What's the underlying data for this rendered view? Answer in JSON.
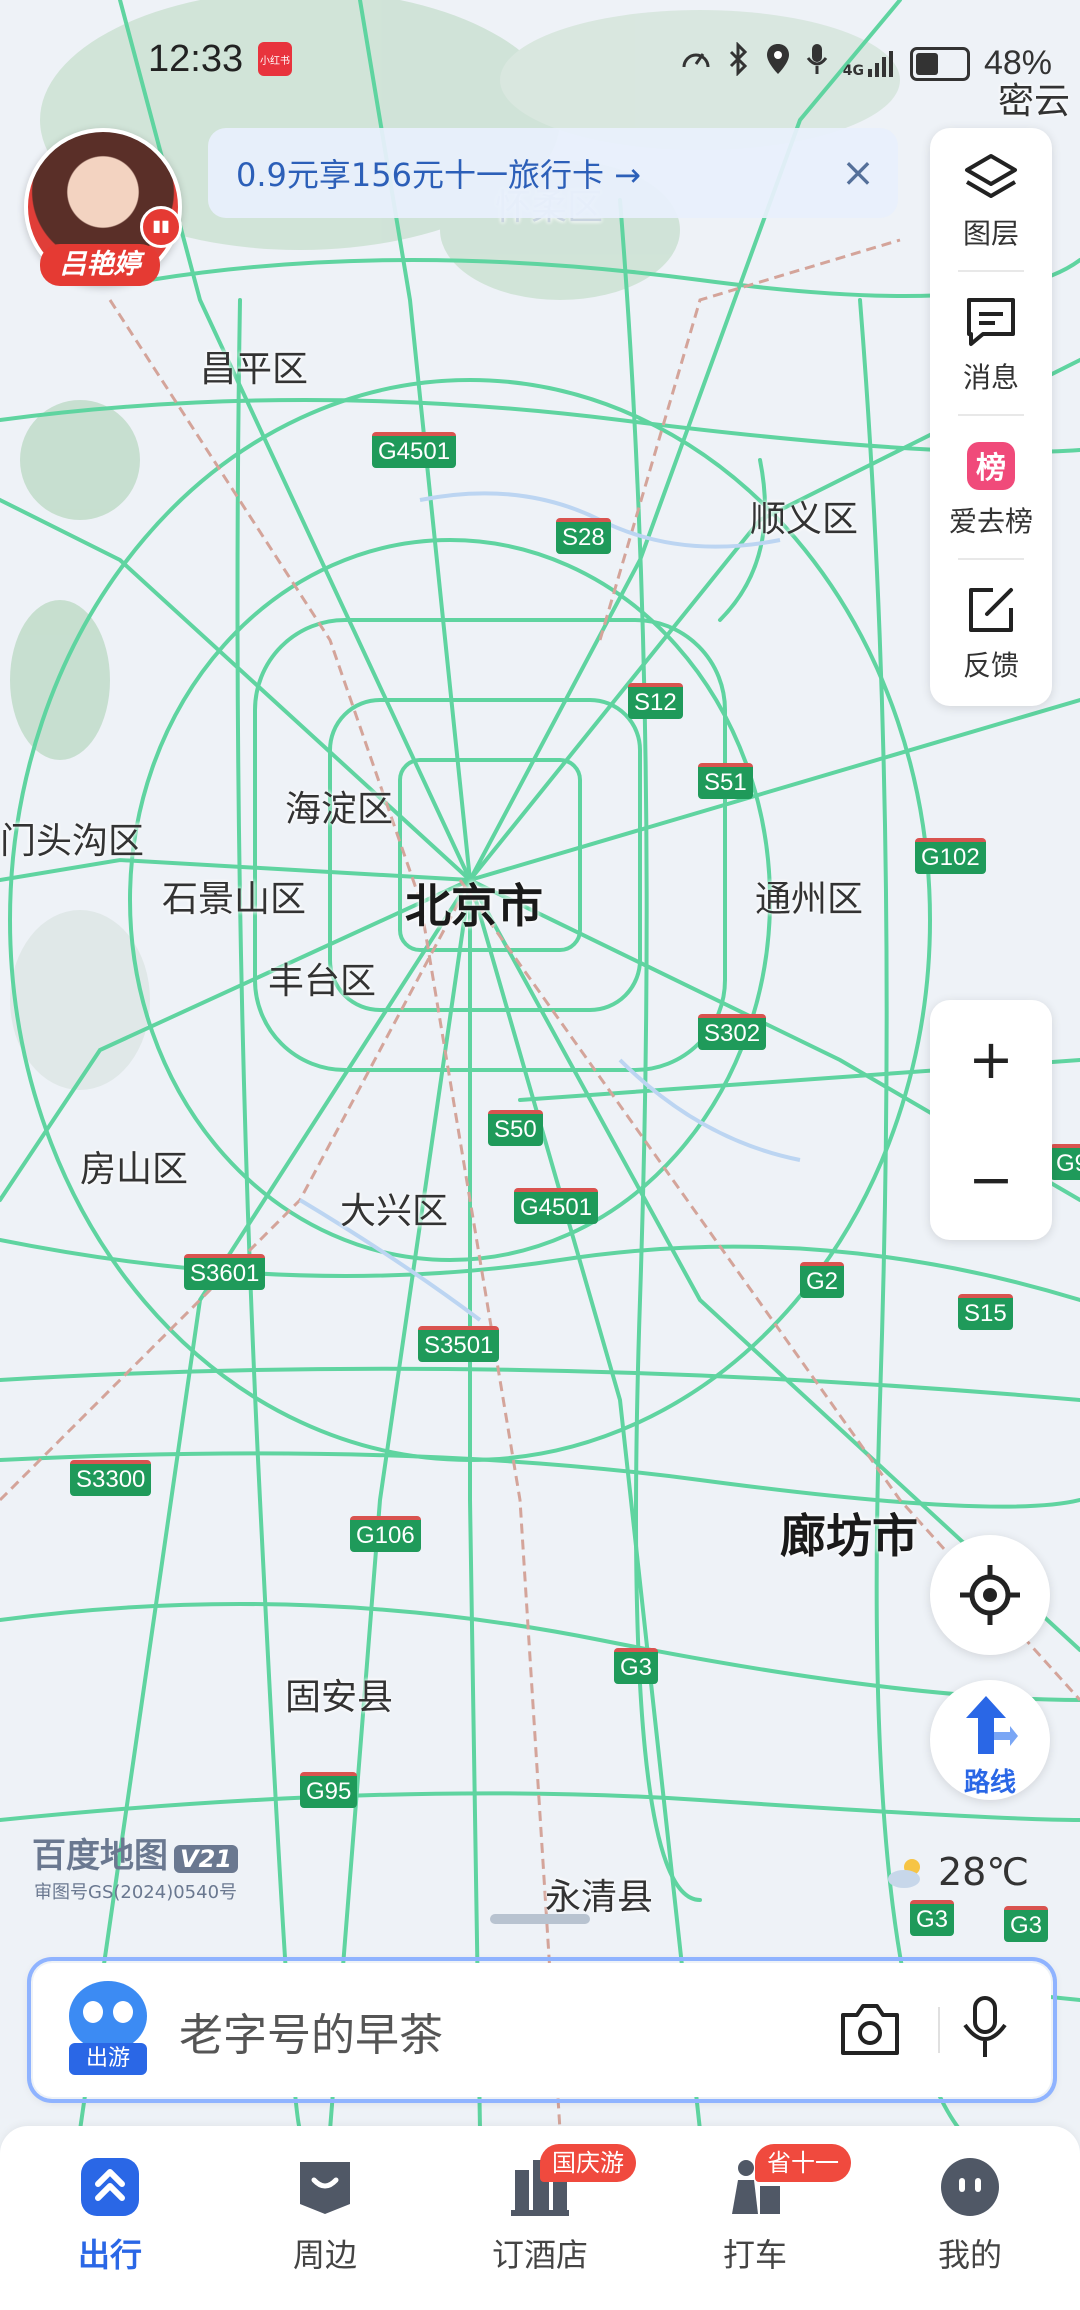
{
  "status_bar": {
    "time": "12:33",
    "app_badge": "小红书",
    "network": "4G",
    "battery": "48%"
  },
  "live_avatar": {
    "name": "吕艳婷"
  },
  "promo_banner": {
    "text": "0.9元享156元十一旅行卡 →",
    "close": "×"
  },
  "side_tools": [
    {
      "label": "图层",
      "icon": "layers-icon"
    },
    {
      "label": "消息",
      "icon": "message-icon"
    },
    {
      "label": "爱去榜",
      "icon": "ranking-icon"
    },
    {
      "label": "反馈",
      "icon": "feedback-icon"
    }
  ],
  "zoom": {
    "in": "+",
    "out": "−"
  },
  "route_button": {
    "label": "路线"
  },
  "map": {
    "brand": "百度地图",
    "brand_version": "V21",
    "approval_no": "审图号GS(2024)0540号",
    "weather": "28℃",
    "places": [
      {
        "name": "密云",
        "size": "md"
      },
      {
        "name": "怀柔区",
        "size": "md"
      },
      {
        "name": "昌平区",
        "size": "md"
      },
      {
        "name": "顺义区",
        "size": "md"
      },
      {
        "name": "海淀区",
        "size": "md"
      },
      {
        "name": "门头沟区",
        "size": "md"
      },
      {
        "name": "石景山区",
        "size": "md"
      },
      {
        "name": "北京市",
        "size": "lg"
      },
      {
        "name": "通州区",
        "size": "md"
      },
      {
        "name": "丰台区",
        "size": "md"
      },
      {
        "name": "房山区",
        "size": "md"
      },
      {
        "name": "大兴区",
        "size": "md"
      },
      {
        "name": "廊坊市",
        "size": "lg"
      },
      {
        "name": "固安县",
        "size": "md"
      },
      {
        "name": "永清县",
        "size": "md"
      }
    ],
    "road_shields": [
      "G4501",
      "S28",
      "S12",
      "S51",
      "G102",
      "S302",
      "S50",
      "G4501",
      "G9",
      "G2",
      "S15",
      "S3601",
      "S3501",
      "S3300",
      "G106",
      "G3",
      "G95",
      "G3",
      "G3"
    ]
  },
  "search": {
    "placeholder": "老字号的早茶",
    "avatar_tag": "出游"
  },
  "bottom_nav": [
    {
      "label": "出行",
      "active": true,
      "badge": ""
    },
    {
      "label": "周边",
      "active": false,
      "badge": ""
    },
    {
      "label": "订酒店",
      "active": false,
      "badge": "国庆游"
    },
    {
      "label": "打车",
      "active": false,
      "badge": "省十一"
    },
    {
      "label": "我的",
      "active": false,
      "badge": ""
    }
  ],
  "colors": {
    "road": "#5fd4a0",
    "accent": "#2a67e6",
    "shield": "#1f9a5a",
    "badge": "#f04a3e"
  }
}
